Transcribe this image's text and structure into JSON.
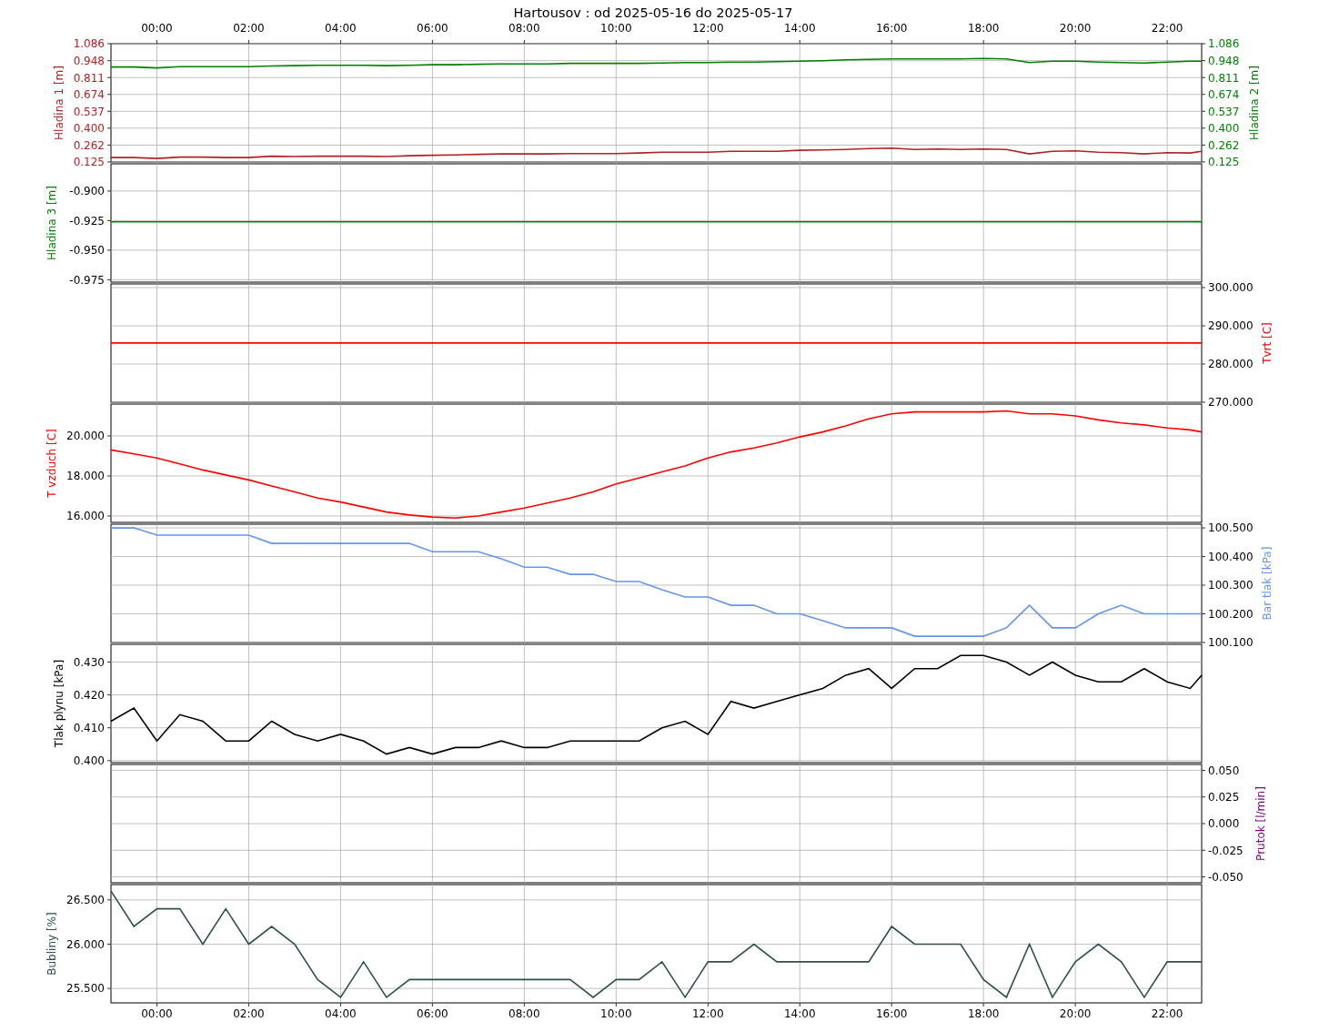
{
  "title": "Hartousov : od 2025-05-16 do 2025-05-17",
  "panels": [
    {
      "xlabels_on_top": true,
      "axes": [
        {
          "kind": "left",
          "label": "Hladina 1 [m]",
          "color": "#b22222",
          "colored_ticks": true
        },
        {
          "kind": "right",
          "label": "Hladina 2 [m]",
          "color": "#008000",
          "colored_ticks": true,
          "tick_labels_top_down": [
            "1.086",
            "0.948",
            "0.811",
            "0.674",
            "0.537",
            "0.400",
            "0.262",
            "0.125"
          ]
        }
      ],
      "chart_data": {
        "type": "line",
        "grid": true,
        "xlim": [
          -1,
          22.75
        ],
        "ylim": [
          0.125,
          1.086
        ],
        "xticks": [
          {
            "value": 0,
            "label": "00:00"
          },
          {
            "value": 2,
            "label": "02:00"
          },
          {
            "value": 4,
            "label": "04:00"
          },
          {
            "value": 6,
            "label": "06:00"
          },
          {
            "value": 8,
            "label": "08:00"
          },
          {
            "value": 10,
            "label": "10:00"
          },
          {
            "value": 12,
            "label": "12:00"
          },
          {
            "value": 14,
            "label": "14:00"
          },
          {
            "value": 16,
            "label": "16:00"
          },
          {
            "value": 18,
            "label": "18:00"
          },
          {
            "value": 20,
            "label": "20:00"
          },
          {
            "value": 22,
            "label": "22:00"
          }
        ],
        "yticks": [
          {
            "value": 0.125,
            "label": "0.125"
          },
          {
            "value": 0.262,
            "label": "0.262"
          },
          {
            "value": 0.4,
            "label": "0.400"
          },
          {
            "value": 0.537,
            "label": "0.537"
          },
          {
            "value": 0.674,
            "label": "0.674"
          },
          {
            "value": 0.811,
            "label": "0.811"
          },
          {
            "value": 0.948,
            "label": "0.948"
          },
          {
            "value": 1.086,
            "label": "1.086"
          }
        ],
        "x": [
          -1,
          -0.5,
          0,
          0.5,
          1,
          1.5,
          2,
          2.5,
          3,
          3.5,
          4,
          4.5,
          5,
          5.5,
          6,
          6.5,
          7,
          7.5,
          8,
          8.5,
          9,
          9.5,
          10,
          10.5,
          11,
          11.5,
          12,
          12.5,
          13,
          13.5,
          14,
          14.5,
          15,
          15.5,
          16,
          16.5,
          17,
          17.5,
          18,
          18.5,
          19,
          19.5,
          20,
          20.5,
          21,
          21.5,
          22,
          22.5,
          22.75
        ],
        "series": [
          {
            "color": "#b22222",
            "values": [
              0.161,
              0.161,
              0.154,
              0.165,
              0.165,
              0.161,
              0.161,
              0.172,
              0.169,
              0.172,
              0.172,
              0.172,
              0.169,
              0.176,
              0.18,
              0.183,
              0.187,
              0.191,
              0.191,
              0.191,
              0.194,
              0.194,
              0.194,
              0.198,
              0.205,
              0.205,
              0.205,
              0.212,
              0.212,
              0.212,
              0.22,
              0.223,
              0.227,
              0.234,
              0.238,
              0.227,
              0.231,
              0.227,
              0.231,
              0.227,
              0.191,
              0.212,
              0.216,
              0.205,
              0.201,
              0.191,
              0.201,
              0.198,
              0.212
            ]
          },
          {
            "color": "#008000",
            "values": [
              0.897,
              0.897,
              0.889,
              0.9,
              0.9,
              0.9,
              0.9,
              0.905,
              0.908,
              0.911,
              0.911,
              0.911,
              0.908,
              0.911,
              0.915,
              0.915,
              0.919,
              0.922,
              0.922,
              0.922,
              0.926,
              0.926,
              0.926,
              0.926,
              0.929,
              0.933,
              0.933,
              0.937,
              0.937,
              0.94,
              0.944,
              0.948,
              0.955,
              0.958,
              0.962,
              0.962,
              0.962,
              0.962,
              0.966,
              0.962,
              0.933,
              0.944,
              0.944,
              0.937,
              0.933,
              0.929,
              0.937,
              0.944,
              0.944
            ]
          }
        ]
      }
    },
    {
      "axes": [
        {
          "kind": "left",
          "label": "Hladina 3 [m]",
          "color": "#008000",
          "colored_ticks": false
        }
      ],
      "chart_data": {
        "type": "line",
        "grid": true,
        "xlim": [
          -1,
          22.75
        ],
        "ylim": [
          -0.977,
          -0.877
        ],
        "yticks": [
          {
            "value": -0.975,
            "label": "-0.975"
          },
          {
            "value": -0.95,
            "label": "-0.950"
          },
          {
            "value": -0.925,
            "label": "-0.925"
          },
          {
            "value": -0.9,
            "label": "-0.900"
          }
        ],
        "x": [
          -1,
          22.75
        ],
        "series": [
          {
            "color": "#008000",
            "values": [
              -0.926,
              -0.926
            ]
          }
        ]
      }
    },
    {
      "axes": [
        {
          "kind": "right",
          "label": "Tvrt [C]",
          "color": "#ff0000",
          "colored_ticks": false
        }
      ],
      "chart_data": {
        "type": "line",
        "grid": true,
        "xlim": [
          -1,
          22.75
        ],
        "ylim": [
          270,
          300.95
        ],
        "yticks": [
          {
            "value": 270,
            "label": "270.000"
          },
          {
            "value": 280,
            "label": "280.000"
          },
          {
            "value": 290,
            "label": "290.000"
          },
          {
            "value": 300,
            "label": "300.000"
          }
        ],
        "x": [
          -1,
          22.75
        ],
        "series": [
          {
            "color": "#ff0000",
            "values": [
              285.5,
              285.5
            ]
          }
        ]
      }
    },
    {
      "axes": [
        {
          "kind": "left",
          "label": "T vzduch [C]",
          "color": "#ff0000",
          "colored_ticks": false
        }
      ],
      "chart_data": {
        "type": "line",
        "grid": true,
        "xlim": [
          -1,
          22.75
        ],
        "ylim": [
          15.68,
          21.59
        ],
        "yticks": [
          {
            "value": 16,
            "label": "16.000"
          },
          {
            "value": 18,
            "label": "18.000"
          },
          {
            "value": 20,
            "label": "20.000"
          }
        ],
        "x": [
          -1,
          -0.5,
          0,
          0.5,
          1,
          1.5,
          2,
          2.5,
          3,
          3.5,
          4,
          4.5,
          5,
          5.5,
          6,
          6.5,
          7,
          7.5,
          8,
          8.5,
          9,
          9.5,
          10,
          10.5,
          11,
          11.5,
          12,
          12.5,
          13,
          13.5,
          14,
          14.5,
          15,
          15.5,
          16,
          16.5,
          17,
          17.5,
          18,
          18.5,
          19,
          19.5,
          20,
          20.5,
          21,
          21.5,
          22,
          22.5,
          22.75
        ],
        "series": [
          {
            "color": "#ff0000",
            "values": [
              19.3,
              19.1,
              18.9,
              18.6,
              18.3,
              18.05,
              17.8,
              17.5,
              17.2,
              16.9,
              16.7,
              16.45,
              16.2,
              16.05,
              15.95,
              15.9,
              16,
              16.2,
              16.4,
              16.65,
              16.9,
              17.2,
              17.6,
              17.9,
              18.2,
              18.5,
              18.9,
              19.2,
              19.4,
              19.65,
              19.95,
              20.2,
              20.5,
              20.85,
              21.1,
              21.2,
              21.2,
              21.2,
              21.2,
              21.25,
              21.1,
              21.1,
              21,
              20.8,
              20.65,
              20.55,
              20.4,
              20.3,
              20.2
            ]
          }
        ]
      }
    },
    {
      "axes": [
        {
          "kind": "right",
          "label": "Bar tlak [kPa]",
          "color": "#6495ed",
          "colored_ticks": false
        }
      ],
      "chart_data": {
        "type": "line",
        "grid": true,
        "xlim": [
          -1,
          22.75
        ],
        "ylim": [
          100.1,
          100.513
        ],
        "yticks": [
          {
            "value": 100.1,
            "label": "100.100"
          },
          {
            "value": 100.2,
            "label": "100.200"
          },
          {
            "value": 100.3,
            "label": "100.300"
          },
          {
            "value": 100.4,
            "label": "100.400"
          },
          {
            "value": 100.5,
            "label": "100.500"
          }
        ],
        "x": [
          -1,
          -0.5,
          0,
          0.5,
          1,
          1.5,
          2,
          2.5,
          3,
          3.5,
          4,
          4.5,
          5,
          5.5,
          6,
          6.5,
          7,
          7.5,
          8,
          8.5,
          9,
          9.5,
          10,
          10.5,
          11,
          11.5,
          12,
          12.5,
          13,
          13.5,
          14,
          14.5,
          15,
          15.5,
          16,
          16.5,
          17,
          17.5,
          18,
          18.5,
          19,
          19.5,
          20,
          20.5,
          21,
          21.5,
          22,
          22.5,
          22.75
        ],
        "series": [
          {
            "color": "#6495ed",
            "values": [
              100.5,
              100.5,
              100.475,
              100.475,
              100.475,
              100.475,
              100.475,
              100.446,
              100.446,
              100.446,
              100.446,
              100.446,
              100.446,
              100.446,
              100.417,
              100.417,
              100.417,
              100.392,
              100.363,
              100.363,
              100.338,
              100.338,
              100.313,
              100.313,
              100.284,
              100.259,
              100.259,
              100.23,
              100.23,
              100.2,
              100.2,
              100.176,
              100.151,
              100.151,
              100.151,
              100.122,
              100.122,
              100.122,
              100.122,
              100.151,
              100.23,
              100.151,
              100.151,
              100.2,
              100.23,
              100.2,
              100.2,
              100.2,
              100.2
            ]
          }
        ]
      }
    },
    {
      "axes": [
        {
          "kind": "left",
          "label": "Tlak plynu [kPa]",
          "color": "#000000",
          "colored_ticks": false
        }
      ],
      "chart_data": {
        "type": "line",
        "grid": true,
        "xlim": [
          -1,
          22.75
        ],
        "ylim": [
          0.3994,
          0.4354
        ],
        "yticks": [
          {
            "value": 0.4,
            "label": "0.400"
          },
          {
            "value": 0.41,
            "label": "0.410"
          },
          {
            "value": 0.42,
            "label": "0.420"
          },
          {
            "value": 0.43,
            "label": "0.430"
          }
        ],
        "x": [
          -1,
          -0.5,
          0,
          0.5,
          1,
          1.5,
          2,
          2.5,
          3,
          3.5,
          4,
          4.5,
          5,
          5.5,
          6,
          6.5,
          7,
          7.5,
          8,
          8.5,
          9,
          9.5,
          10,
          10.5,
          11,
          11.5,
          12,
          12.5,
          13,
          13.5,
          14,
          14.5,
          15,
          15.5,
          16,
          16.5,
          17,
          17.5,
          18,
          18.5,
          19,
          19.5,
          20,
          20.5,
          21,
          21.5,
          22,
          22.5,
          22.75
        ],
        "series": [
          {
            "color": "#000000",
            "values": [
              0.412,
              0.416,
              0.406,
              0.414,
              0.412,
              0.406,
              0.406,
              0.412,
              0.408,
              0.406,
              0.408,
              0.406,
              0.402,
              0.404,
              0.402,
              0.404,
              0.404,
              0.406,
              0.404,
              0.404,
              0.406,
              0.406,
              0.406,
              0.406,
              0.41,
              0.412,
              0.408,
              0.418,
              0.416,
              0.418,
              0.42,
              0.422,
              0.426,
              0.428,
              0.422,
              0.428,
              0.428,
              0.432,
              0.432,
              0.43,
              0.426,
              0.43,
              0.426,
              0.424,
              0.424,
              0.428,
              0.424,
              0.422,
              0.426
            ]
          }
        ]
      }
    },
    {
      "axes": [
        {
          "kind": "right",
          "label": "Prutok [l/min]",
          "color": "#800080",
          "colored_ticks": false
        }
      ],
      "chart_data": {
        "type": "line",
        "grid": true,
        "xlim": [
          -1,
          22.75
        ],
        "ylim": [
          -0.0555,
          0.0555
        ],
        "yticks": [
          {
            "value": -0.05,
            "label": "-0.050"
          },
          {
            "value": -0.025,
            "label": "-0.025"
          },
          {
            "value": 0,
            "label": "0.000"
          },
          {
            "value": 0.025,
            "label": "0.025"
          },
          {
            "value": 0.05,
            "label": "0.050"
          }
        ]
      }
    },
    {
      "axes": [
        {
          "kind": "left",
          "label": "Bubliny [%]",
          "color": "#2f4f4f",
          "colored_ticks": false
        }
      ],
      "chart_data": {
        "type": "line",
        "grid": true,
        "xlim": [
          -1,
          22.75
        ],
        "ylim": [
          25.337,
          26.673
        ],
        "xticks": [
          {
            "value": 0,
            "label": "00:00"
          },
          {
            "value": 2,
            "label": "02:00"
          },
          {
            "value": 4,
            "label": "04:00"
          },
          {
            "value": 6,
            "label": "06:00"
          },
          {
            "value": 8,
            "label": "08:00"
          },
          {
            "value": 10,
            "label": "10:00"
          },
          {
            "value": 12,
            "label": "12:00"
          },
          {
            "value": 14,
            "label": "14:00"
          },
          {
            "value": 16,
            "label": "16:00"
          },
          {
            "value": 18,
            "label": "18:00"
          },
          {
            "value": 20,
            "label": "20:00"
          },
          {
            "value": 22,
            "label": "22:00"
          }
        ],
        "yticks": [
          {
            "value": 25.5,
            "label": "25.500"
          },
          {
            "value": 26,
            "label": "26.000"
          },
          {
            "value": 26.5,
            "label": "26.500"
          }
        ],
        "x": [
          -1,
          -0.5,
          0,
          0.5,
          1,
          1.5,
          2,
          2.5,
          3,
          3.5,
          4,
          4.5,
          5,
          5.5,
          6,
          6.5,
          7,
          7.5,
          8,
          8.5,
          9,
          9.5,
          10,
          10.5,
          11,
          11.5,
          12,
          12.5,
          13,
          13.5,
          14,
          14.5,
          15,
          15.5,
          16,
          16.5,
          17,
          17.5,
          18,
          18.5,
          19,
          19.5,
          20,
          20.5,
          21,
          21.5,
          22,
          22.5,
          22.75
        ],
        "series": [
          {
            "color": "#2f4f4f",
            "values": [
              26.6,
              26.2,
              26.4,
              26.4,
              26,
              26.4,
              26,
              26.2,
              26,
              25.6,
              25.4,
              25.8,
              25.4,
              25.6,
              25.6,
              25.6,
              25.6,
              25.6,
              25.6,
              25.6,
              25.6,
              25.4,
              25.6,
              25.6,
              25.8,
              25.4,
              25.8,
              25.8,
              26,
              25.8,
              25.8,
              25.8,
              25.8,
              25.8,
              26.2,
              26,
              26,
              26,
              25.6,
              25.4,
              26,
              25.4,
              25.8,
              26,
              25.8,
              25.4,
              25.8,
              25.8,
              25.8
            ]
          }
        ]
      }
    }
  ]
}
